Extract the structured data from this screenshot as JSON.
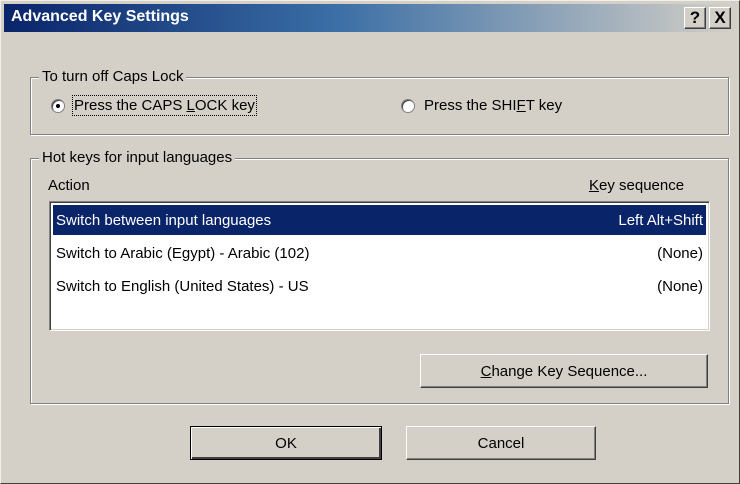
{
  "title": "Advanced Key Settings",
  "title_buttons": {
    "help": "?",
    "close": "X"
  },
  "caps_lock": {
    "legend": "To turn off Caps Lock",
    "option1": {
      "pre": "Press the CAPS ",
      "ul": "L",
      "post": "OCK key",
      "selected": true
    },
    "option2": {
      "pre": "Press the SHI",
      "ul": "F",
      "post": "T key",
      "selected": false
    }
  },
  "hotkeys": {
    "legend": "Hot keys for input languages",
    "col_action": "Action",
    "col_key_ul": "K",
    "col_key_rest": "ey sequence",
    "rows": [
      {
        "action": "Switch between input languages",
        "key": "Left Alt+Shift",
        "selected": true
      },
      {
        "action": "Switch to Arabic (Egypt) - Arabic (102)",
        "key": "(None)",
        "selected": false
      },
      {
        "action": "Switch to English (United States) - US",
        "key": "(None)",
        "selected": false
      }
    ],
    "change_button": {
      "ul": "C",
      "rest": "hange Key Sequence..."
    }
  },
  "buttons": {
    "ok": "OK",
    "cancel": "Cancel"
  },
  "colors": {
    "titlebar_start": "#0a246a",
    "face": "#d4d0c8",
    "selection": "#0a246a"
  }
}
